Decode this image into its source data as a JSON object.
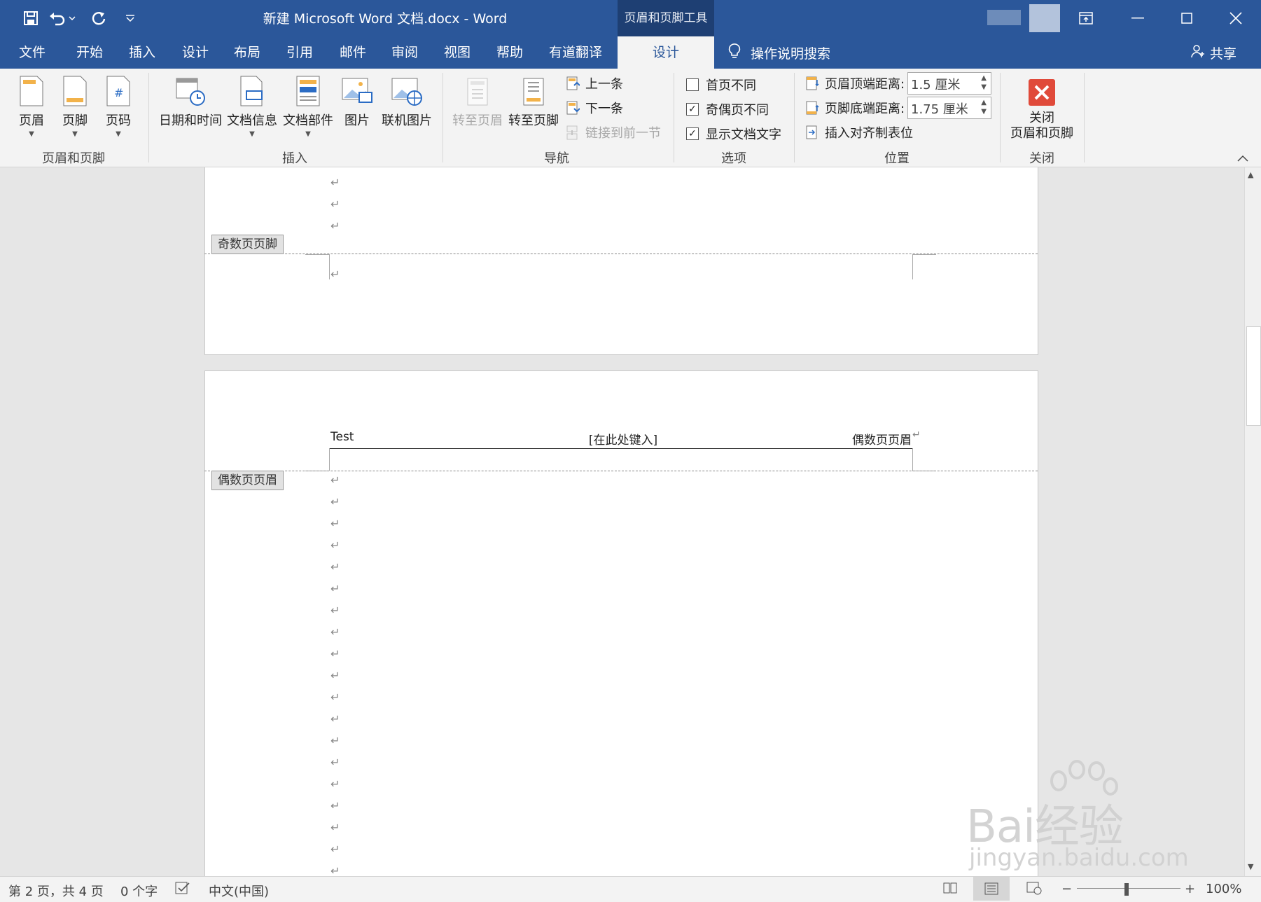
{
  "titlebar": {
    "document_title": "新建 Microsoft Word 文档.docx  -  Word",
    "context_tab": "页眉和页脚工具",
    "qat": [
      "save-icon",
      "undo-icon",
      "redo-icon",
      "customize-qat-icon"
    ]
  },
  "tabs": [
    {
      "label": "文件"
    },
    {
      "label": "开始"
    },
    {
      "label": "插入"
    },
    {
      "label": "设计"
    },
    {
      "label": "布局"
    },
    {
      "label": "引用"
    },
    {
      "label": "邮件"
    },
    {
      "label": "审阅"
    },
    {
      "label": "视图"
    },
    {
      "label": "帮助"
    },
    {
      "label": "有道翻译"
    },
    {
      "label": "设计"
    }
  ],
  "tell_me": "操作说明搜索",
  "share": "共享",
  "ribbon": {
    "groups": {
      "header_footer": "页眉和页脚",
      "insert": "插入",
      "navigation": "导航",
      "options": "选项",
      "position": "位置",
      "close": "关闭"
    },
    "buttons": {
      "header": "页眉",
      "footer": "页脚",
      "page_number": "页码",
      "date_time": "日期和时间",
      "doc_info": "文档信息",
      "quick_parts": "文档部件",
      "pictures": "图片",
      "online_pictures": "联机图片",
      "goto_header": "转至页眉",
      "goto_footer": "转至页脚",
      "previous": "上一条",
      "next": "下一条",
      "link_previous": "链接到前一节",
      "close_line1": "关闭",
      "close_line2": "页眉和页脚"
    },
    "options": {
      "different_first": {
        "label": "首页不同",
        "checked": false
      },
      "different_odd_even": {
        "label": "奇偶页不同",
        "checked": true
      },
      "show_doc_text": {
        "label": "显示文档文字",
        "checked": true
      }
    },
    "position": {
      "header_from_top_label": "页眉顶端距离:",
      "header_from_top_value": "1.5 厘米",
      "footer_from_bottom_label": "页脚底端距离:",
      "footer_from_bottom_value": "1.75 厘米",
      "insert_align_tab": "插入对齐制表位"
    }
  },
  "document": {
    "paragraph_mark": "↵",
    "odd_footer_tag": "奇数页页脚",
    "even_header_tag": "偶数页页眉",
    "even_header": {
      "left": "Test",
      "center": "[在此处键入]",
      "right": "偶数页页眉"
    }
  },
  "statusbar": {
    "page": "第 2 页，共 4 页",
    "words": "0 个字",
    "language": "中文(中国)",
    "zoom": "100%",
    "zoom_minus": "−",
    "zoom_plus": "+"
  },
  "watermark": {
    "brand": "Bai经验",
    "url": "jingyan.baidu.com"
  }
}
